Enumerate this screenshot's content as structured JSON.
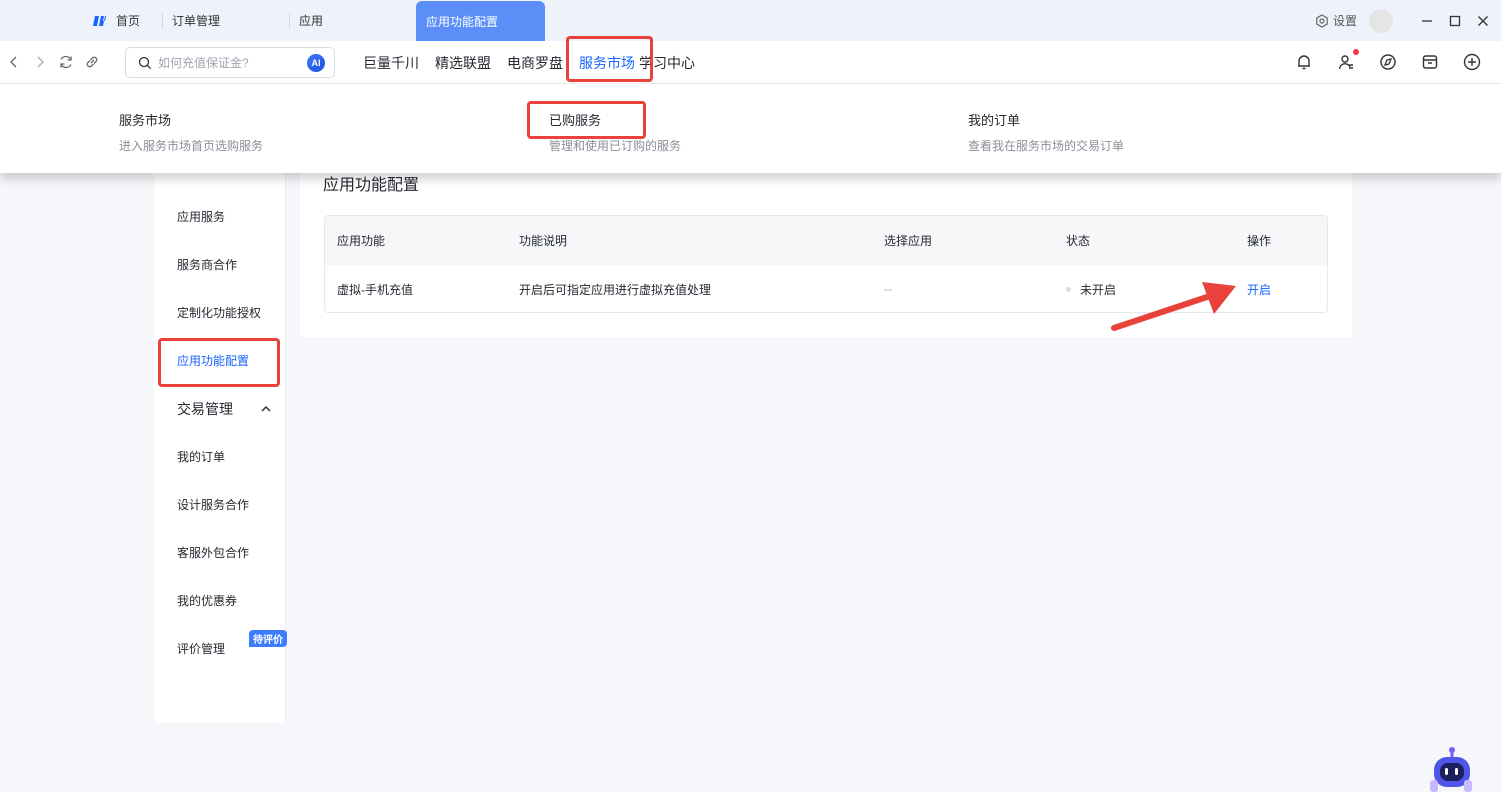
{
  "titlebar": {
    "tabs": [
      "首页",
      "订单管理",
      "应用"
    ],
    "active_tab": "应用功能配置",
    "settings_label": "设置"
  },
  "navbar": {
    "search_placeholder": "如何充值保证金?",
    "ai_label": "AI",
    "menu": [
      "巨量千川",
      "精选联盟",
      "电商罗盘",
      "服务市场",
      "学习中心"
    ],
    "active_menu": "服务市场"
  },
  "dropdown": {
    "items": [
      {
        "title": "服务市场",
        "desc": "进入服务市场首页选购服务"
      },
      {
        "title": "已购服务",
        "desc": "管理和使用已订购的服务"
      },
      {
        "title": "我的订单",
        "desc": "查看我在服务市场的交易订单"
      }
    ]
  },
  "sidebar": {
    "items": [
      "应用服务",
      "服务商合作",
      "定制化功能授权",
      "应用功能配置"
    ],
    "active_item": "应用功能配置",
    "group": "交易管理",
    "group_items": [
      "我的订单",
      "设计服务合作",
      "客服外包合作",
      "我的优惠券",
      "评价管理"
    ],
    "badge": "待评价"
  },
  "main": {
    "title": "应用功能配置",
    "table": {
      "headers": [
        "应用功能",
        "功能说明",
        "选择应用",
        "状态",
        "操作"
      ],
      "rows": [
        {
          "feature": "虚拟-手机充值",
          "desc": "开启后可指定应用进行虚拟充值处理",
          "app": "--",
          "status": "未开启",
          "action": "开启"
        }
      ]
    }
  },
  "colors": {
    "accent": "#1966ff",
    "active_tab_bg": "#5b8ef7",
    "highlight_box": "#e8423a"
  }
}
